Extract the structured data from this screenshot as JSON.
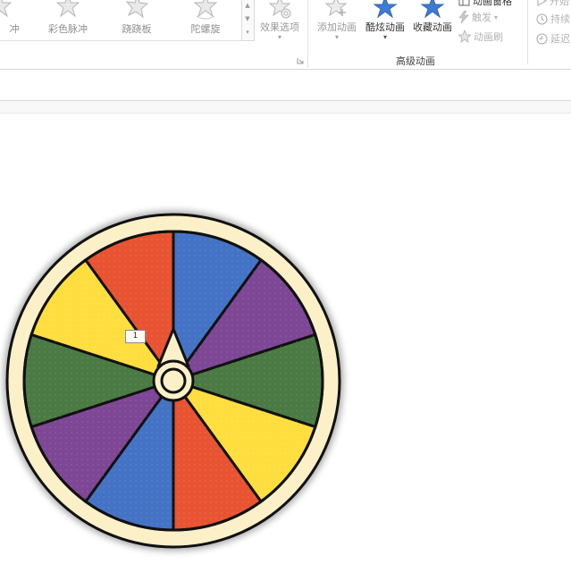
{
  "ribbon": {
    "effects": [
      {
        "label": "冲",
        "icon": "star-icon"
      },
      {
        "label": "彩色脉冲",
        "icon": "star-icon"
      },
      {
        "label": "跷跷板",
        "icon": "star-icon"
      },
      {
        "label": "陀螺旋",
        "icon": "star-icon"
      }
    ],
    "effect_options": {
      "label": "效果选项",
      "caret": "▾"
    },
    "gallery_scroll": {
      "up": "▲",
      "down": "▼",
      "more": "▾"
    },
    "advanced": {
      "group_label": "高级动画",
      "add_animation": {
        "label": "添加动画",
        "caret": "▾"
      },
      "cool_animation": {
        "label": "酷炫动画",
        "caret": "▾"
      },
      "saved_animation": {
        "label": "收藏动画"
      },
      "animation_pane": {
        "label": "动画窗格"
      },
      "trigger": {
        "label": "触发",
        "caret": "▾"
      },
      "animation_painter": {
        "label": "动画刷"
      }
    },
    "timing": {
      "start": {
        "label": "开始"
      },
      "duration": {
        "label": "持续"
      },
      "delay": {
        "label": "延迟"
      }
    }
  },
  "slide": {
    "animation_tag": "1",
    "wheel_colors": [
      "#4472c4",
      "#7e4795",
      "#4c7a44",
      "#fdde3e",
      "#e85432"
    ]
  }
}
